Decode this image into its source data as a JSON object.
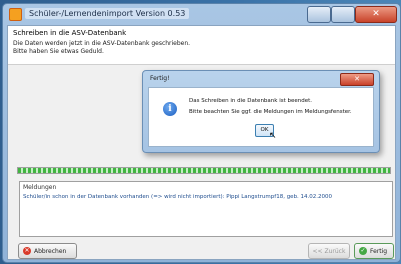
{
  "window": {
    "title": "Schüler-/Lernendenimport Version 0.53"
  },
  "header": {
    "title": "Schreiben in die ASV-Datenbank",
    "line1": "Die Daten werden jetzt in die ASV-Datenbank geschrieben.",
    "line2": "Bitte haben Sie etwas Geduld."
  },
  "progress": {
    "value": 1.0
  },
  "messages": {
    "title": "Meldungen",
    "text": "Schüler/in schon in der Datenbank vorhanden (=> wird nicht importiert): Pippi Langstrumpf18, geb. 14.02.2000"
  },
  "buttons": {
    "cancel": "Abbrechen",
    "back": "<< Zurück",
    "finish": "Fertig"
  },
  "dialog": {
    "title": "Fertig!",
    "close": "✕",
    "line1": "Das Schreiben in die Datenbank ist beendet.",
    "line2": "Bitte beachten Sie ggf. die Meldungen im Meldungsfenster.",
    "ok": "OK"
  },
  "icons": {
    "info": "i",
    "cancel": "✕",
    "finish": "✓",
    "cursor": "↖"
  }
}
